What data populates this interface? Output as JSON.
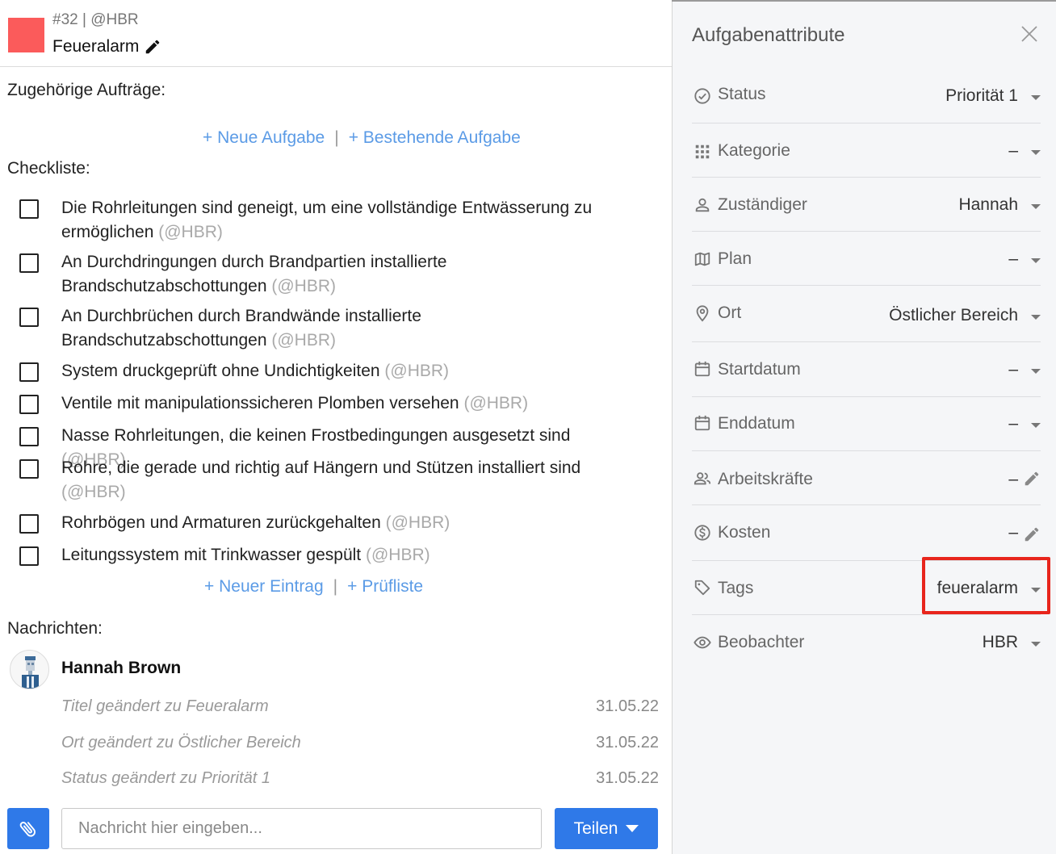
{
  "header": {
    "task_id": "#32 | @HBR",
    "title": "Feueralarm",
    "color": "#fb5b5b"
  },
  "related": {
    "label": "Zugehörige Aufträge:",
    "new_task": "+ Neue Aufgabe",
    "separator": "|",
    "existing_task": "+ Bestehende Aufgabe"
  },
  "checklist": {
    "label": "Checkliste:",
    "items": [
      {
        "text": "Die Rohrleitungen sind geneigt, um eine vollständige Entwässerung zu ermöglichen",
        "owner": "(@HBR)",
        "checked": false
      },
      {
        "text": "An Durchdringungen durch Brandpartien installierte Brandschutzabschottungen",
        "owner": "(@HBR)",
        "checked": false
      },
      {
        "text": "An Durchbrüchen durch Brandwände installierte Brandschutzabschottungen",
        "owner": "(@HBR)",
        "checked": false
      },
      {
        "text": "System druckgeprüft ohne Undichtigkeiten",
        "owner": "(@HBR)",
        "checked": false
      },
      {
        "text": "Ventile mit manipulationssicheren Plomben versehen",
        "owner": "(@HBR)",
        "checked": false
      },
      {
        "text": "Nasse Rohrleitungen, die keinen Frostbedingungen ausgesetzt sind",
        "owner": "(@HBR)",
        "checked": false
      },
      {
        "text": "Rohre, die gerade und richtig auf Hängern und Stützen installiert sind",
        "owner": "(@HBR)",
        "checked": false
      },
      {
        "text": "Rohrbögen und Armaturen zurückgehalten",
        "owner": "(@HBR)",
        "checked": false
      },
      {
        "text": "Leitungssystem mit Trinkwasser gespült",
        "owner": "(@HBR)",
        "checked": false
      }
    ],
    "new_entry": "+ Neuer Eintrag",
    "separator": "|",
    "checklist_link": "+ Prüfliste"
  },
  "messages": {
    "label": "Nachrichten:",
    "author": "Hannah Brown",
    "entries": [
      {
        "text": "Titel geändert zu Feueralarm",
        "date": "31.05.22"
      },
      {
        "text": "Ort geändert zu Östlicher Bereich",
        "date": "31.05.22"
      },
      {
        "text": "Status geändert zu Priorität 1",
        "date": "31.05.22"
      }
    ],
    "input_placeholder": "Nachricht hier eingeben...",
    "share_label": "Teilen"
  },
  "attributes": {
    "title": "Aufgabenattribute",
    "rows": [
      {
        "label": "Status",
        "value": "Priorität 1",
        "icon": "check-circle-icon",
        "control": "dropdown"
      },
      {
        "label": "Kategorie",
        "value": "–",
        "icon": "grid-icon",
        "control": "dropdown"
      },
      {
        "label": "Zuständiger",
        "value": "Hannah",
        "icon": "user-icon",
        "control": "dropdown"
      },
      {
        "label": "Plan",
        "value": "–",
        "icon": "map-icon",
        "control": "dropdown"
      },
      {
        "label": "Ort",
        "value": "Östlicher Bereich",
        "icon": "location-pin-icon",
        "control": "dropdown"
      },
      {
        "label": "Startdatum",
        "value": "–",
        "icon": "calendar-icon",
        "control": "dropdown"
      },
      {
        "label": "Enddatum",
        "value": "–",
        "icon": "calendar-icon",
        "control": "dropdown"
      },
      {
        "label": "Arbeitskräfte",
        "value": "–",
        "icon": "people-icon",
        "control": "edit"
      },
      {
        "label": "Kosten",
        "value": "–",
        "icon": "dollar-circle-icon",
        "control": "edit"
      },
      {
        "label": "Tags",
        "value": "feueralarm",
        "icon": "tag-icon",
        "control": "dropdown"
      },
      {
        "label": "Beobachter",
        "value": "HBR",
        "icon": "eye-icon",
        "control": "dropdown"
      }
    ]
  },
  "colors": {
    "accent": "#2f79e8",
    "link": "#5b9be6",
    "highlight": "#e8251c"
  }
}
